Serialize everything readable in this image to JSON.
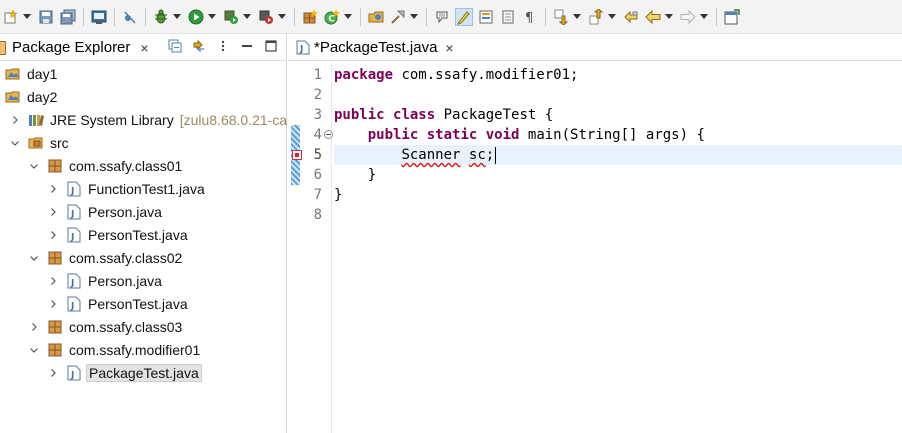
{
  "toolbar": {
    "icons": [
      "new-wizard-icon",
      "save-icon",
      "save-all-icon",
      "console-icon",
      "skip-breakpoints-icon",
      "debug-icon",
      "run-icon",
      "coverage-icon",
      "external-tools-icon",
      "new-java-package-icon",
      "new-java-class-icon",
      "open-type-icon",
      "search-icon",
      "toggle-mark-occurrences-icon",
      "toggle-highlight-icon",
      "show-whitespace-icon",
      "next-annotation-icon",
      "previous-annotation-icon",
      "back-icon",
      "forward-icon",
      "pin-editor-icon"
    ]
  },
  "explorer": {
    "title": "Package Explorer",
    "close_glyph": "×",
    "tree": [
      {
        "label": "day1",
        "type": "project",
        "depth": 0,
        "expandable": false
      },
      {
        "label": "day2",
        "type": "project",
        "depth": 0,
        "expandable": false
      },
      {
        "label": "JRE System Library",
        "decoration": "[zulu8.68.0.21-ca",
        "type": "library",
        "depth": 1,
        "expandable": true,
        "expanded": false
      },
      {
        "label": "src",
        "type": "source-folder",
        "depth": 1,
        "expandable": true,
        "expanded": true
      },
      {
        "label": "com.ssafy.class01",
        "type": "package",
        "depth": 2,
        "expandable": true,
        "expanded": true
      },
      {
        "label": "FunctionTest1.java",
        "type": "java-file",
        "depth": 3,
        "expandable": true,
        "expanded": false
      },
      {
        "label": "Person.java",
        "type": "java-file",
        "depth": 3,
        "expandable": true,
        "expanded": false
      },
      {
        "label": "PersonTest.java",
        "type": "java-file",
        "depth": 3,
        "expandable": true,
        "expanded": false
      },
      {
        "label": "com.ssafy.class02",
        "type": "package",
        "depth": 2,
        "expandable": true,
        "expanded": true
      },
      {
        "label": "Person.java",
        "type": "java-file",
        "depth": 3,
        "expandable": true,
        "expanded": false
      },
      {
        "label": "PersonTest.java",
        "type": "java-file",
        "depth": 3,
        "expandable": true,
        "expanded": false
      },
      {
        "label": "com.ssafy.class03",
        "type": "package",
        "depth": 2,
        "expandable": true,
        "expanded": false
      },
      {
        "label": "com.ssafy.modifier01",
        "type": "package",
        "depth": 2,
        "expandable": true,
        "expanded": true
      },
      {
        "label": "PackageTest.java",
        "type": "java-file",
        "depth": 3,
        "expandable": true,
        "expanded": false,
        "selected": true
      }
    ]
  },
  "editor": {
    "tab_title": "*PackageTest.java",
    "close_glyph": "×",
    "current_line": 5,
    "lines": [
      {
        "num": "1",
        "tokens": [
          {
            "t": "package",
            "k": "kw"
          },
          {
            "t": " com.ssafy.modifier01;"
          }
        ]
      },
      {
        "num": "2",
        "tokens": []
      },
      {
        "num": "3",
        "tokens": [
          {
            "t": "public",
            "k": "kw"
          },
          {
            "t": " "
          },
          {
            "t": "class",
            "k": "kw"
          },
          {
            "t": " PackageTest {"
          }
        ]
      },
      {
        "num": "4",
        "fold": true,
        "tokens": [
          {
            "t": "    "
          },
          {
            "t": "public",
            "k": "kw"
          },
          {
            "t": " "
          },
          {
            "t": "static",
            "k": "kw"
          },
          {
            "t": " "
          },
          {
            "t": "void",
            "k": "kw"
          },
          {
            "t": " main(String[] args) {"
          }
        ]
      },
      {
        "num": "5",
        "error": true,
        "tokens": [
          {
            "t": "        "
          },
          {
            "t": "Scanner",
            "k": "err"
          },
          {
            "t": " "
          },
          {
            "t": "sc",
            "k": "err"
          },
          {
            "t": ";"
          }
        ],
        "caret": true
      },
      {
        "num": "6",
        "tokens": [
          {
            "t": "    }"
          }
        ]
      },
      {
        "num": "7",
        "tokens": [
          {
            "t": "}"
          }
        ]
      },
      {
        "num": "8",
        "tokens": []
      }
    ]
  },
  "colors": {
    "keyword": "#7f0055",
    "current_line": "#e8f2fe",
    "error_underline": "#e21b1b",
    "selection": "#e4e4e4"
  }
}
